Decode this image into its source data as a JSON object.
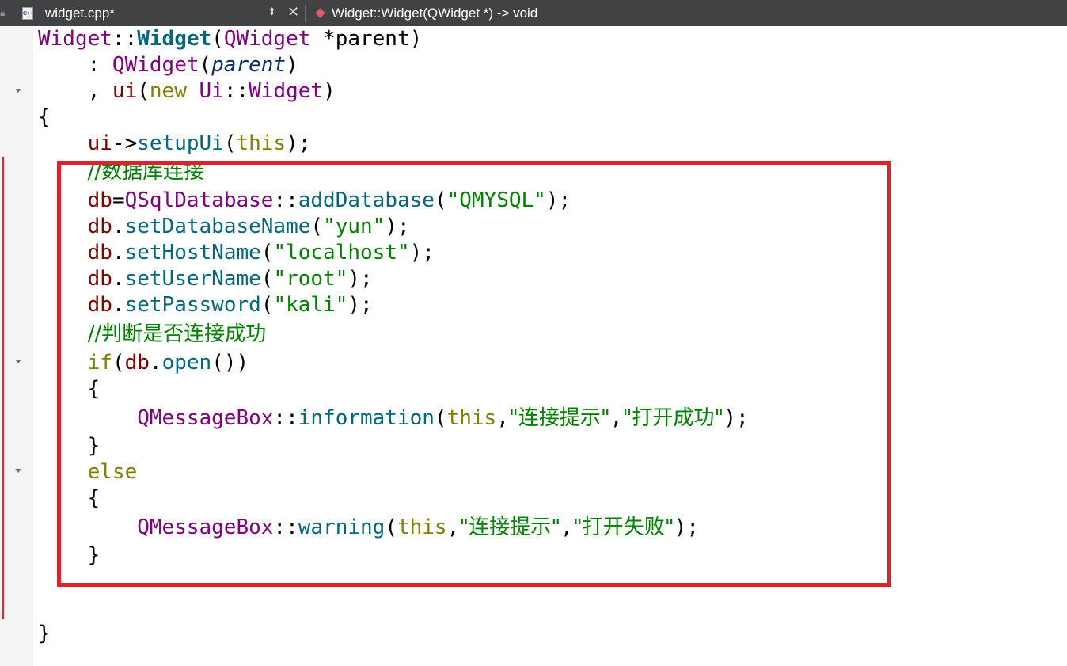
{
  "tab": {
    "filename": "widget.cpp*",
    "symbol": "Widget::Widget(QWidget *) -> void"
  },
  "code": {
    "l1": {
      "a": "Widget",
      "b": "::",
      "c": "Widget",
      "d": "(",
      "e": "QWidget",
      "f": " *parent)"
    },
    "l2": {
      "a": "    : ",
      "b": "QWidget",
      "c": "(",
      "d": "parent",
      "e": ")"
    },
    "l3": {
      "a": "    , ",
      "b": "ui",
      "c": "(",
      "d": "new",
      "e": " ",
      "f": "Ui",
      "g": "::",
      "h": "Widget",
      "i": ")"
    },
    "l4": {
      "a": "{"
    },
    "l5": {
      "a": "    ",
      "b": "ui",
      "c": "->",
      "d": "setupUi",
      "e": "(",
      "f": "this",
      "g": ");"
    },
    "l6": {
      "a": "    ",
      "b": "//数据库连接"
    },
    "l7": {
      "a": "    ",
      "b": "db",
      "c": "=",
      "d": "QSqlDatabase",
      "e": "::",
      "f": "addDatabase",
      "g": "(",
      "h": "\"QMYSQL\"",
      "i": ");"
    },
    "l8": {
      "a": "    ",
      "b": "db",
      "c": ".",
      "d": "setDatabaseName",
      "e": "(",
      "f": "\"yun\"",
      "g": ");"
    },
    "l9": {
      "a": "    ",
      "b": "db",
      "c": ".",
      "d": "setHostName",
      "e": "(",
      "f": "\"localhost\"",
      "g": ");"
    },
    "l10": {
      "a": "    ",
      "b": "db",
      "c": ".",
      "d": "setUserName",
      "e": "(",
      "f": "\"root\"",
      "g": ");"
    },
    "l11": {
      "a": "    ",
      "b": "db",
      "c": ".",
      "d": "setPassword",
      "e": "(",
      "f": "\"kali\"",
      "g": ");"
    },
    "l12": {
      "a": "    ",
      "b": "//判断是否连接成功"
    },
    "l13": {
      "a": "    ",
      "b": "if",
      "c": "(",
      "d": "db",
      "e": ".",
      "f": "open",
      "g": "())"
    },
    "l14": {
      "a": "    {"
    },
    "l15": {
      "a": "        ",
      "b": "QMessageBox",
      "c": "::",
      "d": "information",
      "e": "(",
      "f": "this",
      "g": ",",
      "h": "\"连接提示\"",
      "i": ",",
      "j": "\"打开成功\"",
      "k": ");"
    },
    "l16": {
      "a": "    }"
    },
    "l17": {
      "a": "    ",
      "b": "else"
    },
    "l18": {
      "a": "    {"
    },
    "l19": {
      "a": "        ",
      "b": "QMessageBox",
      "c": "::",
      "d": "warning",
      "e": "(",
      "f": "this",
      "g": ",",
      "h": "\"连接提示\"",
      "i": ",",
      "j": "\"打开失败\"",
      "k": ");"
    },
    "l20": {
      "a": "    }"
    },
    "l21": {
      "a": ""
    },
    "l22": {
      "a": "}"
    }
  },
  "colors": {
    "highlight_border": "#e0202a",
    "change_bar": "#e0282d",
    "type": "#800080",
    "keyword": "#808000",
    "member": "#800000",
    "function": "#00677c",
    "string": "#008000"
  }
}
